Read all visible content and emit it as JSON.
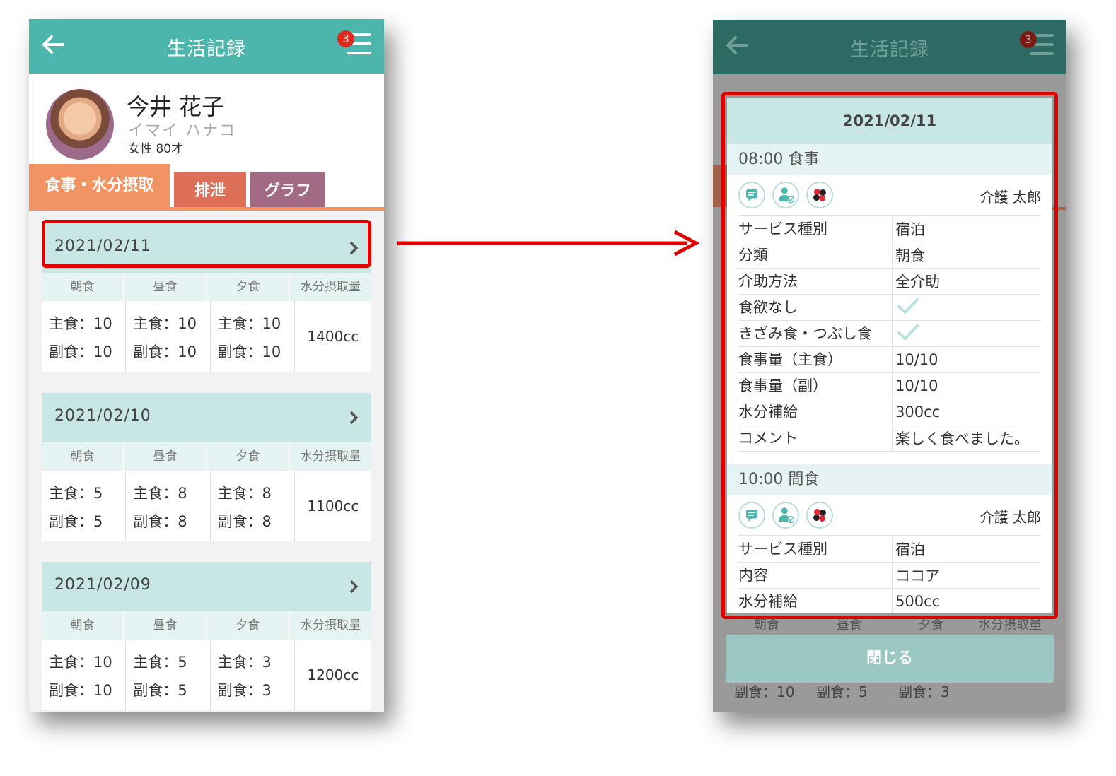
{
  "app": {
    "title": "生活記録",
    "notification_count": "3"
  },
  "profile": {
    "name": "今井 花子",
    "kana": "イマイ ハナコ",
    "meta": "女性 80才"
  },
  "tabs": [
    "食事・水分摂取",
    "排泄",
    "グラフ"
  ],
  "columns": [
    "朝食",
    "昼食",
    "夕食",
    "水分摂取量"
  ],
  "records": [
    {
      "date": "2021/02/11",
      "meals": [
        [
          "主食：10",
          "副食：10"
        ],
        [
          "主食：10",
          "副食：10"
        ],
        [
          "主食：10",
          "副食：10"
        ]
      ],
      "water": "1400cc"
    },
    {
      "date": "2021/02/10",
      "meals": [
        [
          "主食：5",
          "副食：5"
        ],
        [
          "主食：8",
          "副食：8"
        ],
        [
          "主食：8",
          "副食：8"
        ]
      ],
      "water": "1100cc"
    },
    {
      "date": "2021/02/09",
      "meals": [
        [
          "主食：10",
          "副食：10"
        ],
        [
          "主食：5",
          "副食：5"
        ],
        [
          "主食：3",
          "副食：3"
        ]
      ],
      "water": "1200cc"
    }
  ],
  "detail": {
    "date": "2021/02/11",
    "sections": [
      {
        "heading": "08:00  食事",
        "staff": "介護 太郎",
        "rows": [
          {
            "key": "サービス種別",
            "value": "宿泊"
          },
          {
            "key": "分類",
            "value": "朝食"
          },
          {
            "key": "介助方法",
            "value": "全介助"
          },
          {
            "key": "食欲なし",
            "value": ""
          },
          {
            "key": "きざみ食・つぶし食",
            "value": ""
          },
          {
            "key": "食事量（主食）",
            "value": "10/10"
          },
          {
            "key": "食事量（副）",
            "value": "10/10"
          },
          {
            "key": "水分補給",
            "value": "300cc"
          },
          {
            "key": "コメント",
            "value": "楽しく食べました。"
          }
        ]
      },
      {
        "heading": "10:00  間食",
        "staff": "介護 太郎",
        "rows": [
          {
            "key": "サービス種別",
            "value": "宿泊"
          },
          {
            "key": "内容",
            "value": "ココア"
          },
          {
            "key": "水分補給",
            "value": "500cc"
          }
        ]
      }
    ],
    "close_label": "閉じる",
    "behind_text": {
      "cols": [
        "朝食",
        "昼食",
        "夕食",
        "水分摂取量"
      ],
      "sub": [
        "副食：10",
        "副食：5",
        "副食：3"
      ]
    }
  },
  "colors": {
    "teal": "#4db6ac",
    "highlight": "#e00000",
    "meal_tab": "#f29363",
    "excretion_tab": "#de6f57",
    "graph_tab": "#a26b83"
  },
  "icons": [
    "back-arrow-icon",
    "menu-icon",
    "chevron-right-icon",
    "comment-icon",
    "caregiver-icon",
    "flower-icon",
    "check-icon"
  ]
}
